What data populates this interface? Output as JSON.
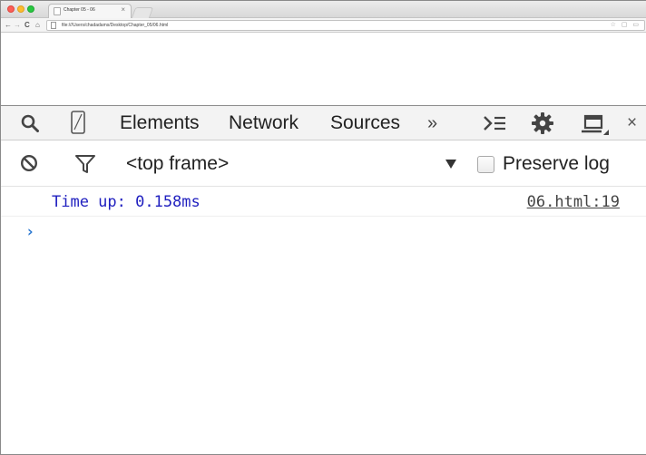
{
  "browser": {
    "tab_title": "Chapter 05 - 06",
    "tab_close": "×",
    "nav_back": "←",
    "nav_forward": "→",
    "nav_reload": "C",
    "nav_home": "⌂",
    "url": "file:///Users/chadadams/Desktop/Chapter_05/06.html",
    "omnibox_icons": "☆ ▢ ▭"
  },
  "devtools": {
    "tabs": [
      {
        "label": "Elements"
      },
      {
        "label": "Network"
      },
      {
        "label": "Sources"
      }
    ],
    "overflow_label": "»",
    "close_label": "×"
  },
  "console": {
    "frame_select": "<top frame>",
    "preserve_log_label": "Preserve log",
    "preserve_log_checked": false,
    "messages": [
      {
        "text": "Time up: 0.158ms",
        "source": "06.html:19"
      }
    ],
    "prompt_symbol": "›",
    "prompt_value": ""
  },
  "colors": {
    "log_text": "#1f1fbf",
    "prompt_accent": "#2b78d0",
    "toolbar_bg": "#f3f3f3"
  },
  "icons": [
    "search-icon",
    "device-mode-icon",
    "drawer-icon",
    "gear-icon",
    "dock-icon",
    "close-icon",
    "clear-console-icon",
    "filter-icon",
    "dropdown-arrow-icon"
  ]
}
